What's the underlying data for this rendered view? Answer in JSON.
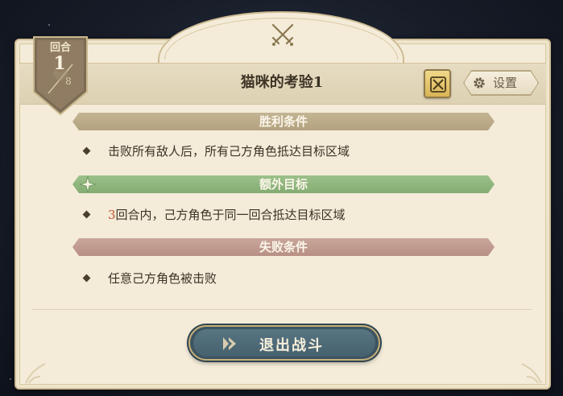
{
  "round": {
    "label": "回合",
    "current": "1",
    "max": "8"
  },
  "title": "猫咪的考验1",
  "settings": {
    "label": "设置",
    "icon": "gear-icon"
  },
  "book_icon": "book-icon",
  "sections": {
    "victory": {
      "title": "胜利条件",
      "items": [
        "击败所有敌人后，所有己方角色抵达目标区域"
      ]
    },
    "extra": {
      "title": "额外目标",
      "number": "3",
      "text": "回合内，己方角色于同一回合抵达目标区域"
    },
    "defeat": {
      "title": "失败条件",
      "items": [
        "任意己方角色被击败"
      ]
    }
  },
  "exit_button": {
    "label": "退出战斗",
    "icon": "play-arrow-icon"
  },
  "colors": {
    "panel": "#f4ecd9",
    "victory_banner": "#b8a883",
    "extra_banner": "#8fb67d",
    "defeat_banner": "#c09a8f",
    "exit_button": "#4d6774",
    "highlight_number": "#c6502e"
  }
}
